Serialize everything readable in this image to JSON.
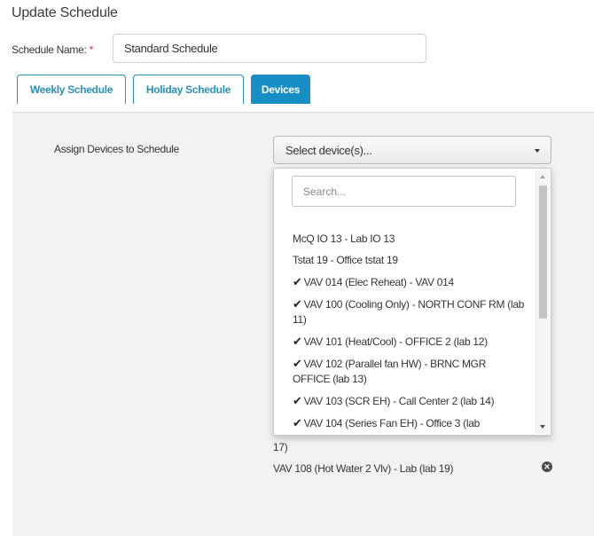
{
  "page": {
    "title": "Update Schedule"
  },
  "schedule_name": {
    "label": "Schedule Name:",
    "required_mark": "*",
    "value": "Standard Schedule"
  },
  "tabs": [
    {
      "label": "Weekly Schedule",
      "active": false
    },
    {
      "label": "Holiday Schedule",
      "active": false
    },
    {
      "label": "Devices",
      "active": true
    }
  ],
  "devices": {
    "assign_label": "Assign Devices to Schedule",
    "select_placeholder": "Select device(s)...",
    "search_placeholder": "Search...",
    "check_glyph": "✔",
    "options": [
      {
        "label": "McQ IO 13 - Lab IO 13",
        "selected": false
      },
      {
        "label": "Tstat 19 - Office tstat 19",
        "selected": false
      },
      {
        "label": "VAV 014 (Elec Reheat) - VAV 014",
        "selected": true
      },
      {
        "label": "VAV 100 (Cooling Only) - NORTH CONF RM (lab 11)",
        "selected": true
      },
      {
        "label": "VAV 101 (Heat/Cool) - OFFICE 2 (lab 12)",
        "selected": true
      },
      {
        "label": "VAV 102 (Parallel fan HW) - BRNC MGR OFFICE (lab 13)",
        "selected": true
      },
      {
        "label": "VAV 103 (SCR EH) - Call Center 2 (lab 14)",
        "selected": true
      },
      {
        "label": "VAV 104 (Series Fan EH) - Office 3 (lab",
        "selected": true
      }
    ],
    "assigned_partial_text": "17)",
    "assigned_last": "VAV 108 (Hot Water 2 Vlv) - Lab (lab 19)",
    "remove_glyph": "✕"
  },
  "colors": {
    "accent": "#188fc4",
    "required": "#d9302c",
    "panel": "#f2f2f2"
  },
  "icons": [
    "caret-down-icon",
    "checkmark-icon",
    "remove-icon",
    "scroll-up-icon",
    "scroll-down-icon"
  ]
}
